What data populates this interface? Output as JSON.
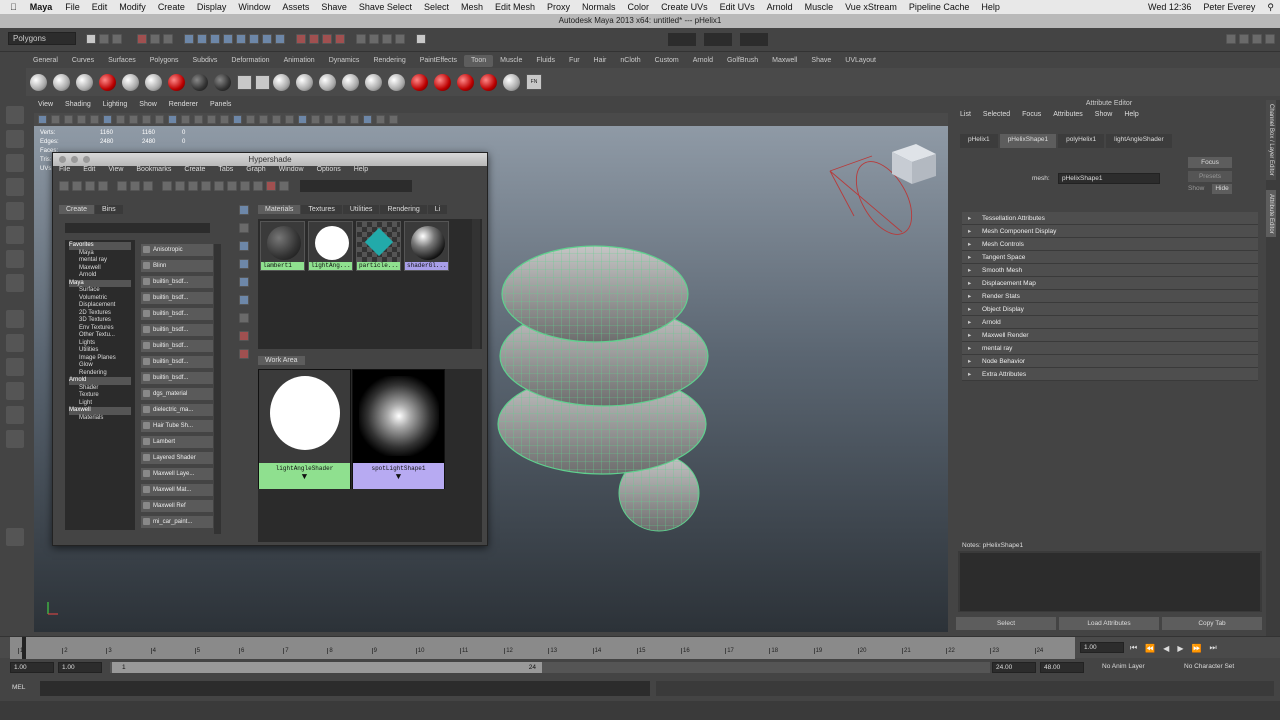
{
  "mac_menu": {
    "app": "Maya",
    "items": [
      "File",
      "Edit",
      "Modify",
      "Create",
      "Display",
      "Window",
      "Assets",
      "Shave",
      "Shave Select",
      "Select",
      "Mesh",
      "Edit Mesh",
      "Proxy",
      "Normals",
      "Color",
      "Create UVs",
      "Edit UVs",
      "Arnold",
      "Muscle",
      "Vue xStream",
      "Pipeline Cache",
      "Help"
    ],
    "clock": "Wed 12:36",
    "user": "Peter Everey"
  },
  "window_title": "Autodesk Maya 2013 x64: untitled*  ---  pHelix1",
  "status_line": {
    "mode": "Polygons"
  },
  "shelf": {
    "tabs": [
      "General",
      "Curves",
      "Surfaces",
      "Polygons",
      "Subdivs",
      "Deformation",
      "Animation",
      "Dynamics",
      "Rendering",
      "PaintEffects",
      "Toon",
      "Muscle",
      "Fluids",
      "Fur",
      "Hair",
      "nCloth",
      "Custom",
      "Arnold",
      "GolfBrush",
      "Maxwell",
      "Shave",
      "UVLayout"
    ],
    "active_tab": "Toon",
    "last_icon_label": "FN"
  },
  "viewport": {
    "menu": [
      "View",
      "Shading",
      "Lighting",
      "Show",
      "Renderer",
      "Panels"
    ],
    "hud": [
      {
        "label": "Verts:",
        "a": "1160",
        "b": "1160",
        "c": "0"
      },
      {
        "label": "Edges:",
        "a": "2480",
        "b": "2480",
        "c": "0"
      },
      {
        "label": "Faces:",
        "a": "",
        "b": "",
        "c": ""
      },
      {
        "label": "Tris:",
        "a": "",
        "b": "",
        "c": ""
      },
      {
        "label": "UVs:",
        "a": "",
        "b": "",
        "c": ""
      }
    ]
  },
  "hypershade": {
    "title": "Hypershade",
    "menu": [
      "File",
      "Edit",
      "View",
      "Bookmarks",
      "Create",
      "Tabs",
      "Graph",
      "Window",
      "Options",
      "Help"
    ],
    "left_tabs": [
      "Create",
      "Bins"
    ],
    "tree": [
      {
        "label": "Favorites",
        "header": true
      },
      {
        "label": "Maya",
        "sub": true
      },
      {
        "label": "mental ray",
        "sub": true
      },
      {
        "label": "Maxwell",
        "sub": true
      },
      {
        "label": "Arnold",
        "sub": true
      },
      {
        "label": "Maya",
        "header": true
      },
      {
        "label": "Surface",
        "sub": true
      },
      {
        "label": "Volumetric",
        "sub": true
      },
      {
        "label": "Displacement",
        "sub": true
      },
      {
        "label": "2D Textures",
        "sub": true
      },
      {
        "label": "3D Textures",
        "sub": true
      },
      {
        "label": "Env Textures",
        "sub": true
      },
      {
        "label": "Other Textu...",
        "sub": true
      },
      {
        "label": "Lights",
        "sub": true
      },
      {
        "label": "Utilities",
        "sub": true
      },
      {
        "label": "Image Planes",
        "sub": true
      },
      {
        "label": "Glow",
        "sub": true
      },
      {
        "label": "Rendering",
        "sub": true
      },
      {
        "label": "Arnold",
        "header": true
      },
      {
        "label": "Shader",
        "sub": true
      },
      {
        "label": "Texture",
        "sub": true
      },
      {
        "label": "Light",
        "sub": true
      },
      {
        "label": "Maxwell",
        "header": true
      },
      {
        "label": "Materials",
        "sub": true
      }
    ],
    "create_buttons": [
      "Anisotropic",
      "Blinn",
      "builtin_bsdf...",
      "builtin_bsdf...",
      "builtin_bsdf...",
      "builtin_bsdf...",
      "builtin_bsdf...",
      "builtin_bsdf...",
      "builtin_bsdf...",
      "dgs_material",
      "dielectric_ma...",
      "Hair Tube Sh...",
      "Lambert",
      "Layered Shader",
      "Maxwell Laye...",
      "Maxwell Mat...",
      "Maxwell Ref",
      "mi_car_paint..."
    ],
    "top_tabs": [
      "Materials",
      "Textures",
      "Utilities",
      "Rendering",
      "Li"
    ],
    "materials": [
      {
        "name": "lambert1",
        "color": "#8fe08f"
      },
      {
        "name": "lightAng...",
        "color": "#8fe08f"
      },
      {
        "name": "particle...",
        "color": "#8fe08f"
      },
      {
        "name": "shaderGl...",
        "color": "#a89ee8"
      }
    ],
    "work_area_tab": "Work Area",
    "work_nodes": [
      {
        "name": "lightAngleShader",
        "color": "#8fe08f"
      },
      {
        "name": "spotLightShape1",
        "color": "#b7aaf2"
      }
    ]
  },
  "attribute_editor": {
    "title": "Attribute Editor",
    "menu": [
      "List",
      "Selected",
      "Focus",
      "Attributes",
      "Show",
      "Help"
    ],
    "tabs": [
      "pHelix1",
      "pHelixShape1",
      "polyHelix1",
      "lightAngleShader"
    ],
    "active_tab": "pHelixShape1",
    "mesh_label": "mesh:",
    "mesh_value": "pHelixShape1",
    "focus_label": "Focus",
    "presets_label": "Presets",
    "show_label": "Show",
    "hide_label": "Hide",
    "sections": [
      "Tessellation Attributes",
      "Mesh Component Display",
      "Mesh Controls",
      "Tangent Space",
      "Smooth Mesh",
      "Displacement Map",
      "Render Stats",
      "Object Display",
      "Arnold",
      "Maxwell Render",
      "mental ray",
      "Node Behavior",
      "Extra Attributes"
    ],
    "notes_label": "Notes:  pHelixShape1",
    "buttons": [
      "Select",
      "Load Attributes",
      "Copy Tab"
    ],
    "side_tabs": [
      "Channel Box / Layer Editor",
      "Attribute Editor"
    ]
  },
  "timeline": {
    "ticks": [
      "1",
      "2",
      "3",
      "4",
      "5",
      "6",
      "7",
      "8",
      "9",
      "10",
      "11",
      "12",
      "13",
      "14",
      "15",
      "16",
      "17",
      "18",
      "19",
      "20",
      "21",
      "22",
      "23",
      "24"
    ],
    "current_frame": "1.00"
  },
  "range": {
    "start": "1.00",
    "start2": "1.00",
    "slider_start": "1",
    "slider_end": "24",
    "end": "24.00",
    "end2": "48.00",
    "anim_layer": "No Anim Layer",
    "char_set": "No Character Set"
  },
  "cmdline": {
    "label": "MEL"
  }
}
